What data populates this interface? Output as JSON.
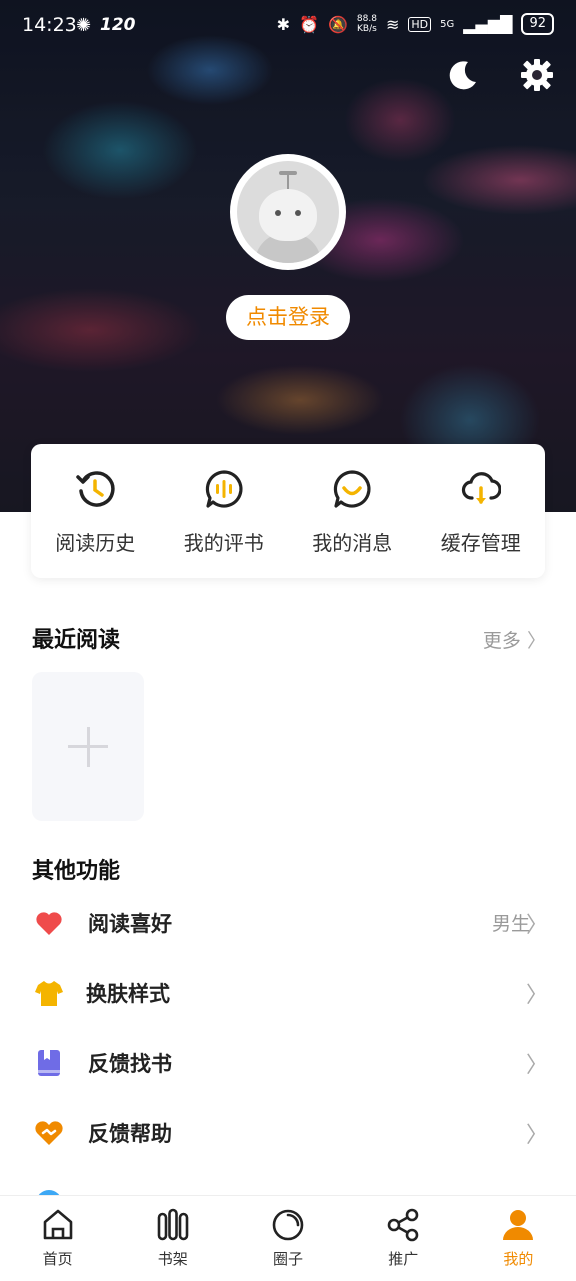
{
  "status_bar": {
    "time": "14:23",
    "refresh_rate": "120",
    "net_speed_value": "88.8",
    "net_speed_unit": "KB/s",
    "hd_badge": "HD",
    "signal_label": "5G",
    "battery": "92"
  },
  "header": {
    "night_mode_icon": "moon-icon",
    "settings_icon": "gear-icon",
    "login_label": "点击登录"
  },
  "quick_actions": [
    {
      "label": "阅读历史",
      "icon": "history-clock-icon"
    },
    {
      "label": "我的评书",
      "icon": "audio-bubble-icon"
    },
    {
      "label": "我的消息",
      "icon": "message-smile-icon"
    },
    {
      "label": "缓存管理",
      "icon": "cloud-download-icon"
    }
  ],
  "recent_reading": {
    "title": "最近阅读",
    "more_label": "更多"
  },
  "other_features": {
    "title": "其他功能",
    "items": [
      {
        "label": "阅读喜好",
        "value": "男生",
        "icon": "heart-icon",
        "color": "#ef4b4b"
      },
      {
        "label": "换肤样式",
        "value": "",
        "icon": "tshirt-icon",
        "color": "#f4b400"
      },
      {
        "label": "反馈找书",
        "value": "",
        "icon": "book-icon",
        "color": "#6f6ce6"
      },
      {
        "label": "反馈帮助",
        "value": "",
        "icon": "help-heart-icon",
        "color": "#f08a00"
      }
    ]
  },
  "bottom_nav": [
    {
      "label": "首页",
      "icon": "home-icon",
      "active": false
    },
    {
      "label": "书架",
      "icon": "bookshelf-icon",
      "active": false
    },
    {
      "label": "圈子",
      "icon": "circle-icon",
      "active": false
    },
    {
      "label": "推广",
      "icon": "share-icon",
      "active": false
    },
    {
      "label": "我的",
      "icon": "profile-icon",
      "active": true
    }
  ],
  "colors": {
    "accent": "#f08a00",
    "muted_text": "#9a9a9a"
  }
}
